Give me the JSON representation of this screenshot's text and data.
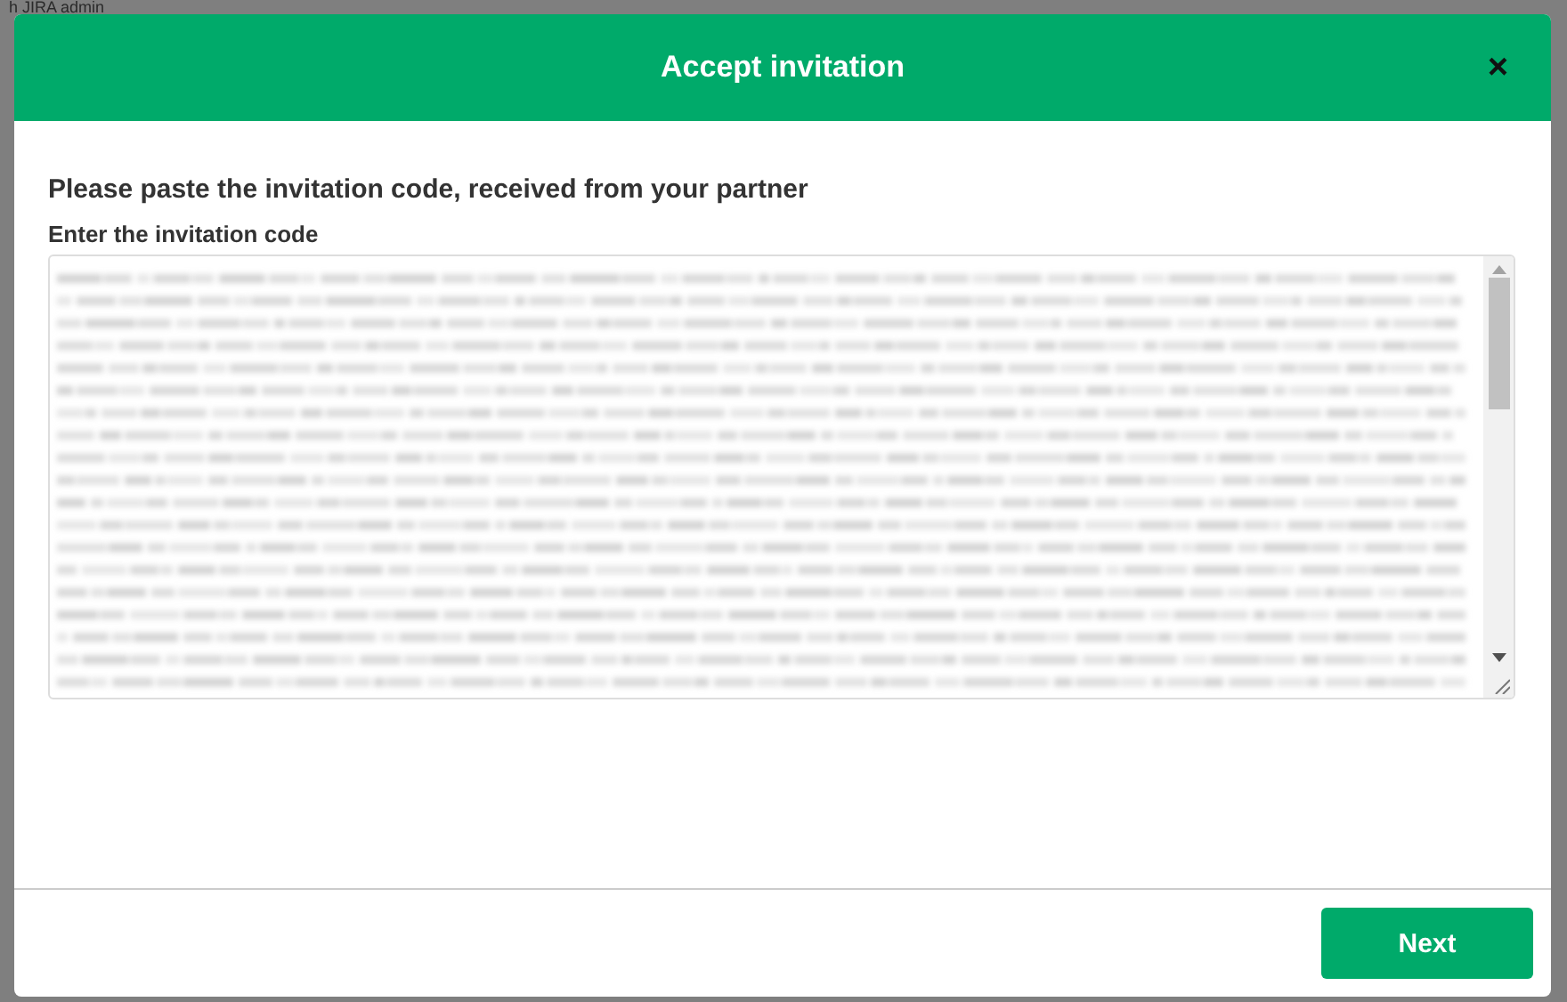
{
  "backdrop": {
    "text": "h JIRA admin"
  },
  "dialog": {
    "title": "Accept invitation",
    "close": "×",
    "prompt": "Please paste the invitation code, received from your partner",
    "field": {
      "label": "Enter the invitation code"
    },
    "buttons": [
      {
        "label": "Next"
      }
    ]
  }
}
